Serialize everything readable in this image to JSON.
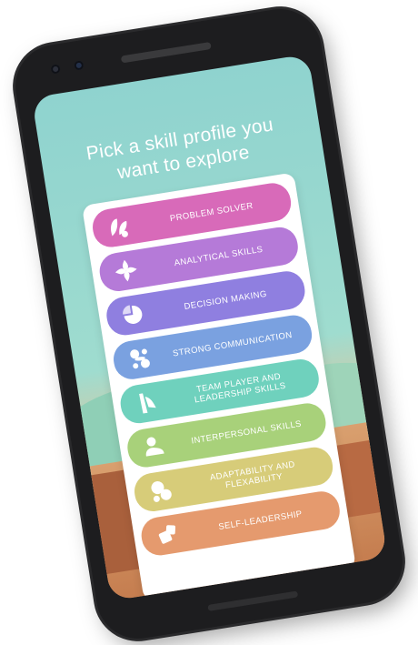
{
  "screen": {
    "title_line1": "Pick a skill profile you",
    "title_line2": "want to explore"
  },
  "skills": [
    {
      "label": "PROBLEM SOLVER",
      "color": "#d86ab9",
      "icon": "leaf-cluster-icon"
    },
    {
      "label": "ANALYTICAL SKILLS",
      "color": "#b57ad8",
      "icon": "cross-petals-icon"
    },
    {
      "label": "DECISION MAKING",
      "color": "#8f7fe0",
      "icon": "pie-shape-icon"
    },
    {
      "label": "STRONG COMMUNICATION",
      "color": "#7aa1e0",
      "icon": "connected-blobs-icon"
    },
    {
      "label": "TEAM PLAYER AND LEADERSHIP SKILLS",
      "color": "#6fd1bd",
      "icon": "flag-shape-icon"
    },
    {
      "label": "INTERPERSONAL SKILLS",
      "color": "#a8d17a",
      "icon": "person-blob-icon"
    },
    {
      "label": "ADAPTABILITY AND FLEXABILITY",
      "color": "#d7cc79",
      "icon": "bubbles-icon"
    },
    {
      "label": "SELF-LEADERSHIP",
      "color": "#e59a6e",
      "icon": "stacked-squares-icon"
    }
  ]
}
